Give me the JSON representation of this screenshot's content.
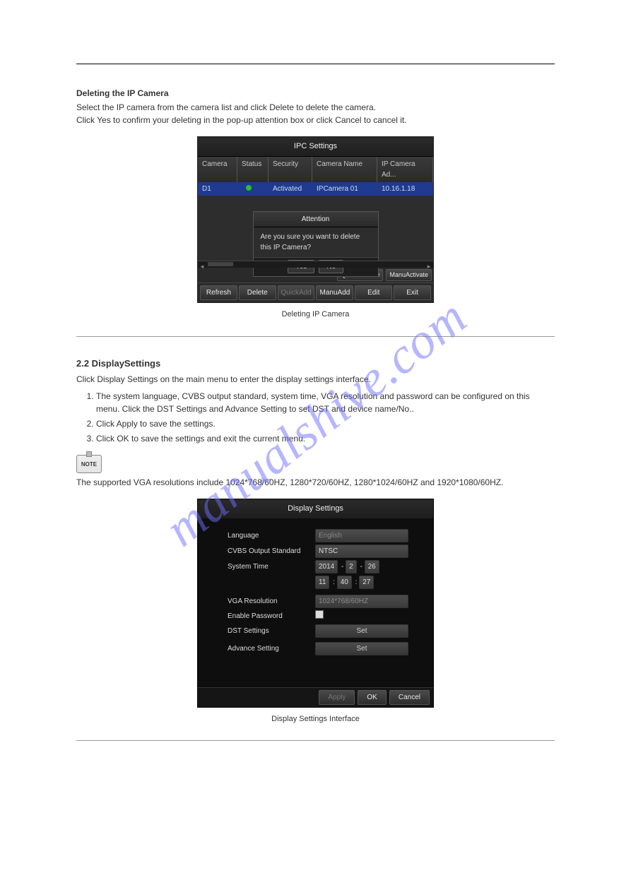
{
  "watermark": "manualshive.com",
  "body": {
    "para1": "Select the IP camera from the camera list and click Delete to delete the camera.",
    "para2": "Click Yes to confirm your deleting in the pop-up attention box or click Cancel to cancel it.",
    "para_display_intro": "Click Display Settings on the main menu to enter the display settings interface.",
    "para_display_resolution": "The supported VGA resolutions include 1024*768/60HZ, 1280*720/60HZ, 1280*1024/60HZ and 1920*1080/60HZ.",
    "list": {
      "i0": "The system language, CVBS output standard, system time, VGA resolution and password can be configured on this menu. Click the DST Settings and Advance Setting to set DST and device name/No..",
      "i1": "Click Apply to save the settings.",
      "i2": "Click OK to save the settings and exit the current menu."
    }
  },
  "headings": {
    "deleting": "Deleting the IP Camera",
    "display": "2.2 DisplaySettings",
    "caption_delete": "Deleting IP Camera",
    "caption_display": "Display Settings Interface"
  },
  "ipc": {
    "title": "IPC Settings",
    "headers": {
      "camera": "Camera",
      "status": "Status",
      "security": "Security",
      "cname": "Camera Name",
      "ip": "IP Camera Ad..."
    },
    "row": {
      "camera": "D1",
      "security": "Activated",
      "cname": "IPCamera 01",
      "ip": "10.16.1.18"
    },
    "dialog": {
      "title": "Attention",
      "msg": "Are you sure you want to delete this IP Camera?",
      "yes": "Yes",
      "no": "No"
    },
    "status_buttons": {
      "quick": "QuickActivate",
      "manu": "ManuActivate"
    },
    "buttons": {
      "refresh": "Refresh",
      "delete": "Delete",
      "quickadd": "QuickAdd",
      "manuadd": "ManuAdd",
      "edit": "Edit",
      "exit": "Exit"
    }
  },
  "disp": {
    "title": "Display Settings",
    "labels": {
      "lang": "Language",
      "cvbs": "CVBS Output Standard",
      "time": "System Time",
      "vga": "VGA Resolution",
      "pwd": "Enable Password",
      "dst": "DST Settings",
      "adv": "Advance Setting"
    },
    "values": {
      "lang": "English",
      "cvbs": "NTSC",
      "date_y": "2014",
      "date_m": "2",
      "date_d": "26",
      "t_h": "11",
      "t_m": "40",
      "t_s": "27",
      "vga": "1024*768/60HZ",
      "set": "Set"
    },
    "footer": {
      "apply": "Apply",
      "ok": "OK",
      "cancel": "Cancel"
    }
  },
  "note_label": "NOTE"
}
